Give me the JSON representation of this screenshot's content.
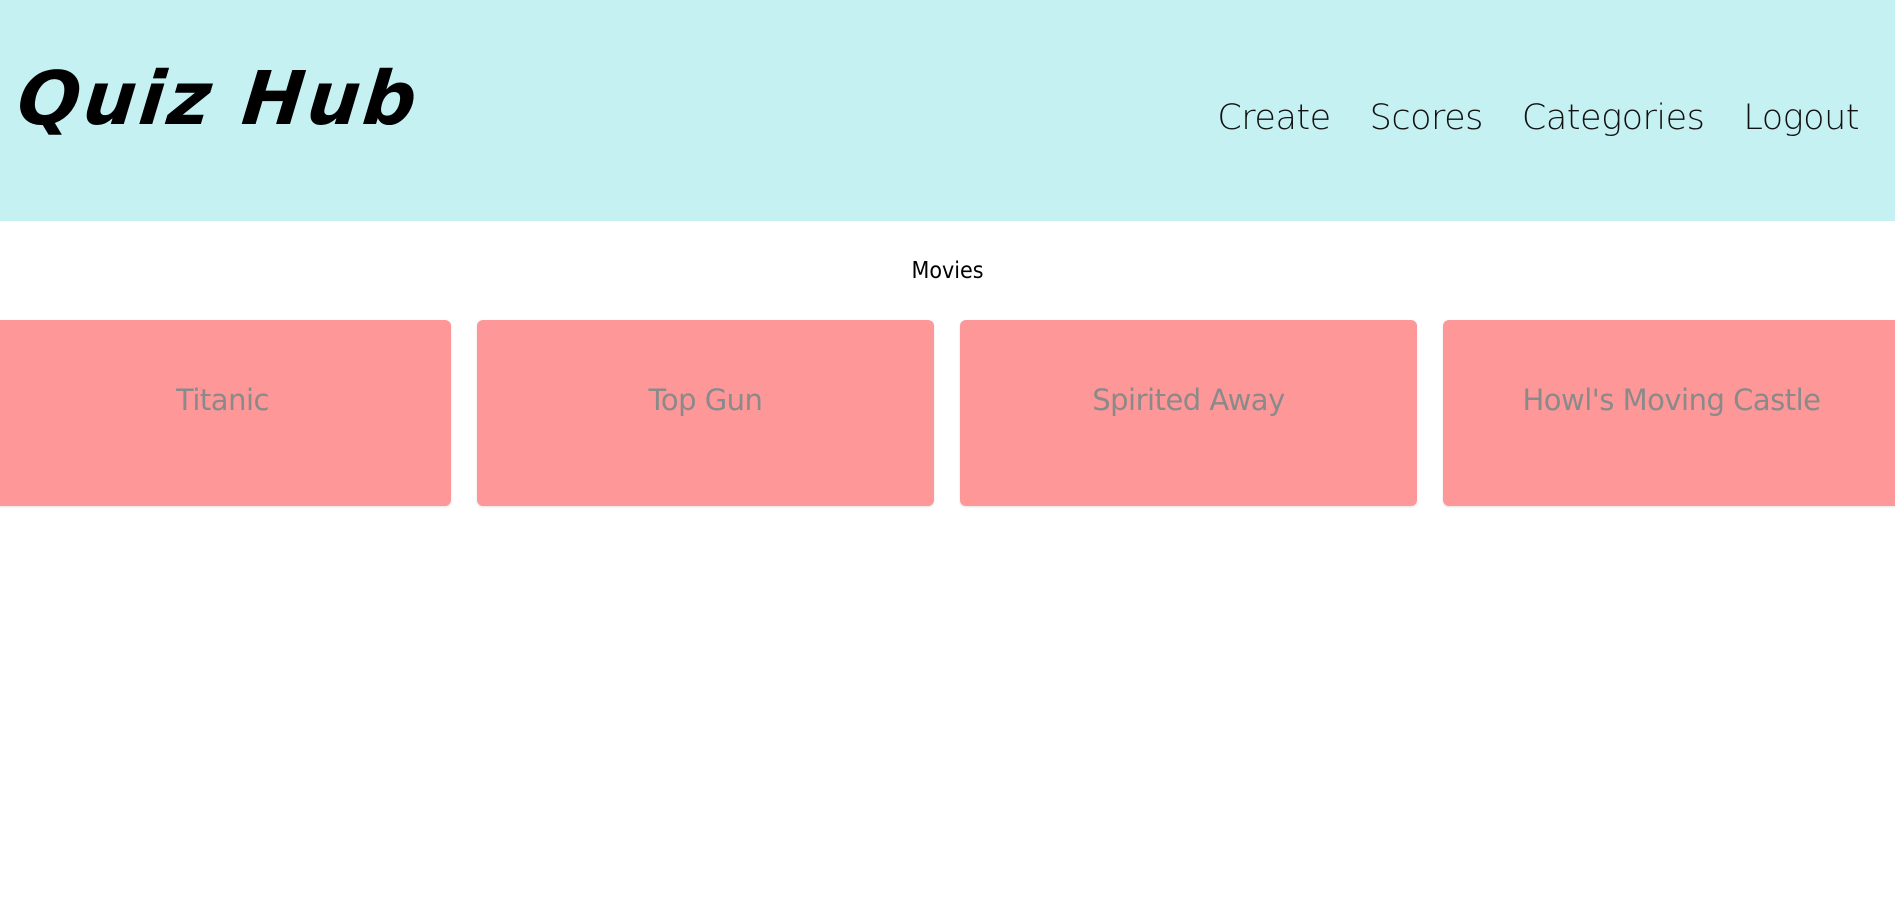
{
  "header": {
    "logo_text": "Quiz Hub",
    "nav": [
      {
        "label": "Create"
      },
      {
        "label": "Scores"
      },
      {
        "label": "Categories"
      },
      {
        "label": "Logout"
      }
    ],
    "background_color": "#c6f1f3"
  },
  "main": {
    "category_title": "Movies",
    "quizzes": [
      {
        "title": "Titanic"
      },
      {
        "title": "Top Gun"
      },
      {
        "title": "Spirited Away"
      },
      {
        "title": "Howl's Moving Castle"
      }
    ],
    "card_color": "#fe9798"
  }
}
